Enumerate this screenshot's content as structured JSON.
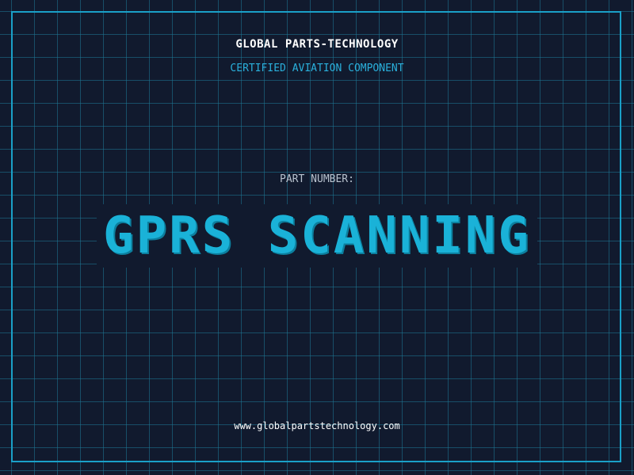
{
  "header": {
    "brand": "GLOBAL PARTS-TECHNOLOGY",
    "tagline": "CERTIFIED AVIATION COMPONENT"
  },
  "part": {
    "label": "PART NUMBER:",
    "number": "GPRS SCANNING"
  },
  "footer": {
    "website": "www.globalpartstechnology.com"
  },
  "colors": {
    "background": "#111a2e",
    "grid": "#1e7896",
    "frame": "#1aa0c8",
    "accent": "#1ab2d8",
    "text": "#ffffff",
    "muted": "#b9c3cf"
  }
}
